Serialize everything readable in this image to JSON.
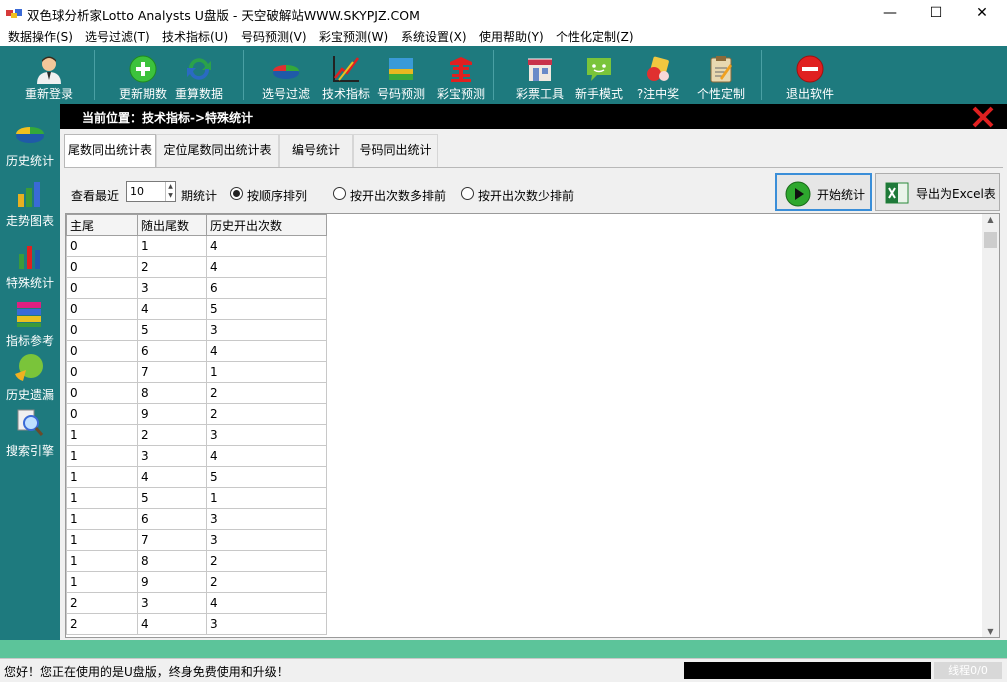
{
  "window": {
    "title": "双色球分析家Lotto Analysts U盘版 - 天空破解站WWW.SKYPJZ.COM",
    "minimize": "—",
    "maximize": "☐",
    "close": "✕"
  },
  "menu": [
    "数据操作(S)",
    "选号过滤(T)",
    "技术指标(U)",
    "号码预测(V)",
    "彩宝预测(W)",
    "系统设置(X)",
    "使用帮助(Y)",
    "个性化定制(Z)"
  ],
  "toolbar": [
    {
      "label": "重新登录",
      "icon": "user-icon"
    },
    {
      "label": "更新期数",
      "icon": "plus-icon"
    },
    {
      "label": "重算数据",
      "icon": "refresh-icon"
    },
    {
      "label": "选号过滤",
      "icon": "pie-filter-icon"
    },
    {
      "label": "技术指标",
      "icon": "chart-line-icon"
    },
    {
      "label": "号码预测",
      "icon": "predict-icon"
    },
    {
      "label": "彩宝预测",
      "icon": "treasure-icon"
    },
    {
      "label": "彩票工具",
      "icon": "shop-icon"
    },
    {
      "label": "新手模式",
      "icon": "chat-icon"
    },
    {
      "label": "?注中奖",
      "icon": "prize-icon"
    },
    {
      "label": "个性定制",
      "icon": "clipboard-icon"
    },
    {
      "label": "退出软件",
      "icon": "exit-icon"
    }
  ],
  "sidebar": [
    {
      "label": "历史统计",
      "icon": "pie-chart-icon"
    },
    {
      "label": "走势图表",
      "icon": "bar-chart-icon"
    },
    {
      "label": "特殊统计",
      "icon": "column-chart-icon"
    },
    {
      "label": "指标参考",
      "icon": "books-icon"
    },
    {
      "label": "历史遗漏",
      "icon": "pie-slice-icon"
    },
    {
      "label": "搜索引擎",
      "icon": "magnifier-icon"
    }
  ],
  "location": {
    "text": "当前位置：技术指标->特殊统计"
  },
  "tabs": [
    "尾数同出统计表",
    "定位尾数同出统计表",
    "编号统计",
    "号码同出统计"
  ],
  "controls": {
    "view_recent": "查看最近",
    "period_value": "10",
    "period_suffix": "期统计",
    "radio_order": "按顺序排列",
    "radio_more": "按开出次数多排前",
    "radio_less": "按开出次数少排前",
    "start_button": "开始统计",
    "export_button": "导出为Excel表"
  },
  "table": {
    "columns": [
      "主尾",
      "随出尾数",
      "历史开出次数"
    ],
    "rows": [
      [
        "0",
        "1",
        "4"
      ],
      [
        "0",
        "2",
        "4"
      ],
      [
        "0",
        "3",
        "6"
      ],
      [
        "0",
        "4",
        "5"
      ],
      [
        "0",
        "5",
        "3"
      ],
      [
        "0",
        "6",
        "4"
      ],
      [
        "0",
        "7",
        "1"
      ],
      [
        "0",
        "8",
        "2"
      ],
      [
        "0",
        "9",
        "2"
      ],
      [
        "1",
        "2",
        "3"
      ],
      [
        "1",
        "3",
        "4"
      ],
      [
        "1",
        "4",
        "5"
      ],
      [
        "1",
        "5",
        "1"
      ],
      [
        "1",
        "6",
        "3"
      ],
      [
        "1",
        "7",
        "3"
      ],
      [
        "1",
        "8",
        "2"
      ],
      [
        "1",
        "9",
        "2"
      ],
      [
        "2",
        "3",
        "4"
      ],
      [
        "2",
        "4",
        "3"
      ]
    ]
  },
  "status": {
    "message": "您好！您正在使用的是U盘版，终身免费使用和升级！",
    "thread": "线程0/0"
  },
  "colors": {
    "toolbar_bg": "#1e7a7e",
    "status_stripe": "#5cc49a",
    "location_bg": "#000000"
  }
}
